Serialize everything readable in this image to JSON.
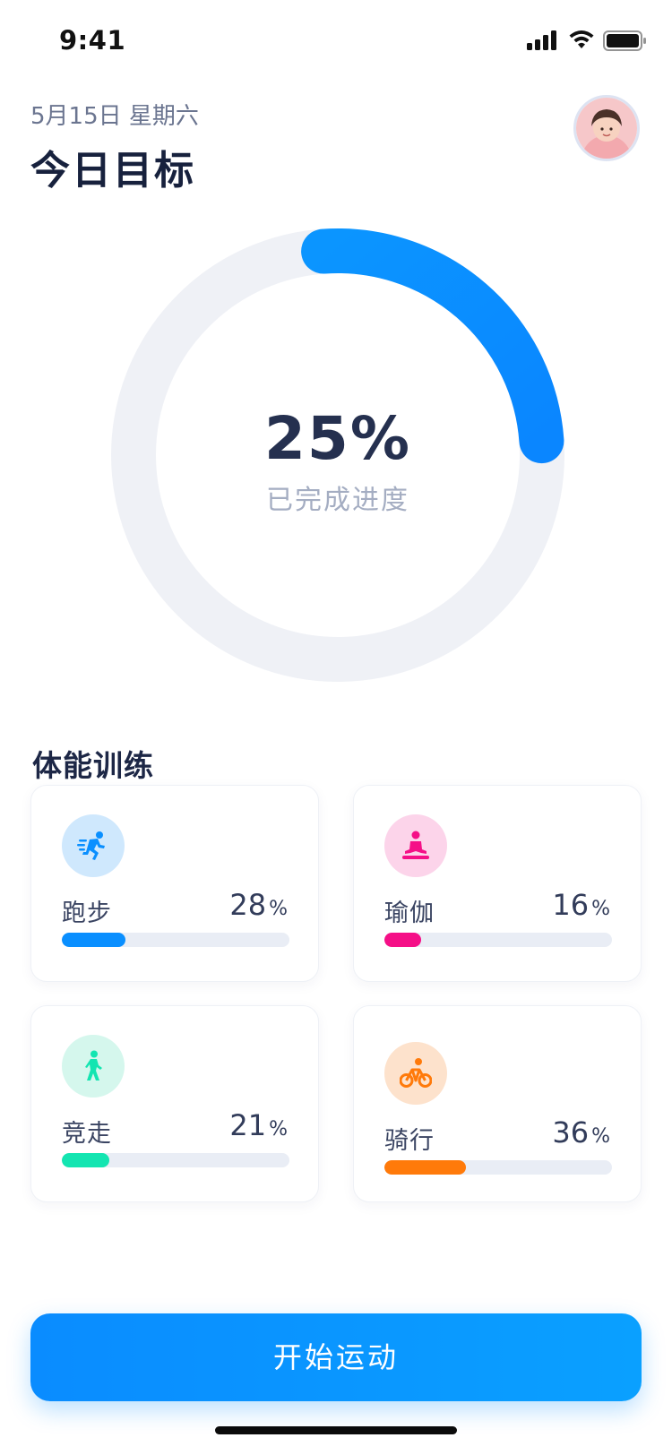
{
  "status_bar": {
    "time": "9:41"
  },
  "header": {
    "date": "5月15日 星期六",
    "title": "今日目标"
  },
  "progress": {
    "value": 25,
    "percent_label": "25%",
    "label": "已完成进度",
    "track_color": "#eff1f6",
    "accent": "#0a8fff"
  },
  "section": {
    "title": "体能训练"
  },
  "activities": [
    {
      "name": "跑步",
      "percent": 28,
      "icon": "running-icon",
      "color": "#0a8fff",
      "bg": "#cfe8fd"
    },
    {
      "name": "瑜伽",
      "percent": 16,
      "icon": "yoga-icon",
      "color": "#f50f87",
      "bg": "#fcd4ea"
    },
    {
      "name": "竞走",
      "percent": 21,
      "icon": "walking-icon",
      "color": "#13e5b1",
      "bg": "#d5f7ed"
    },
    {
      "name": "骑行",
      "percent": 36,
      "icon": "cycling-icon",
      "color": "#ff7a0a",
      "bg": "#fde2cc"
    }
  ],
  "percent_unit": "%",
  "cta": {
    "label": "开始运动"
  }
}
